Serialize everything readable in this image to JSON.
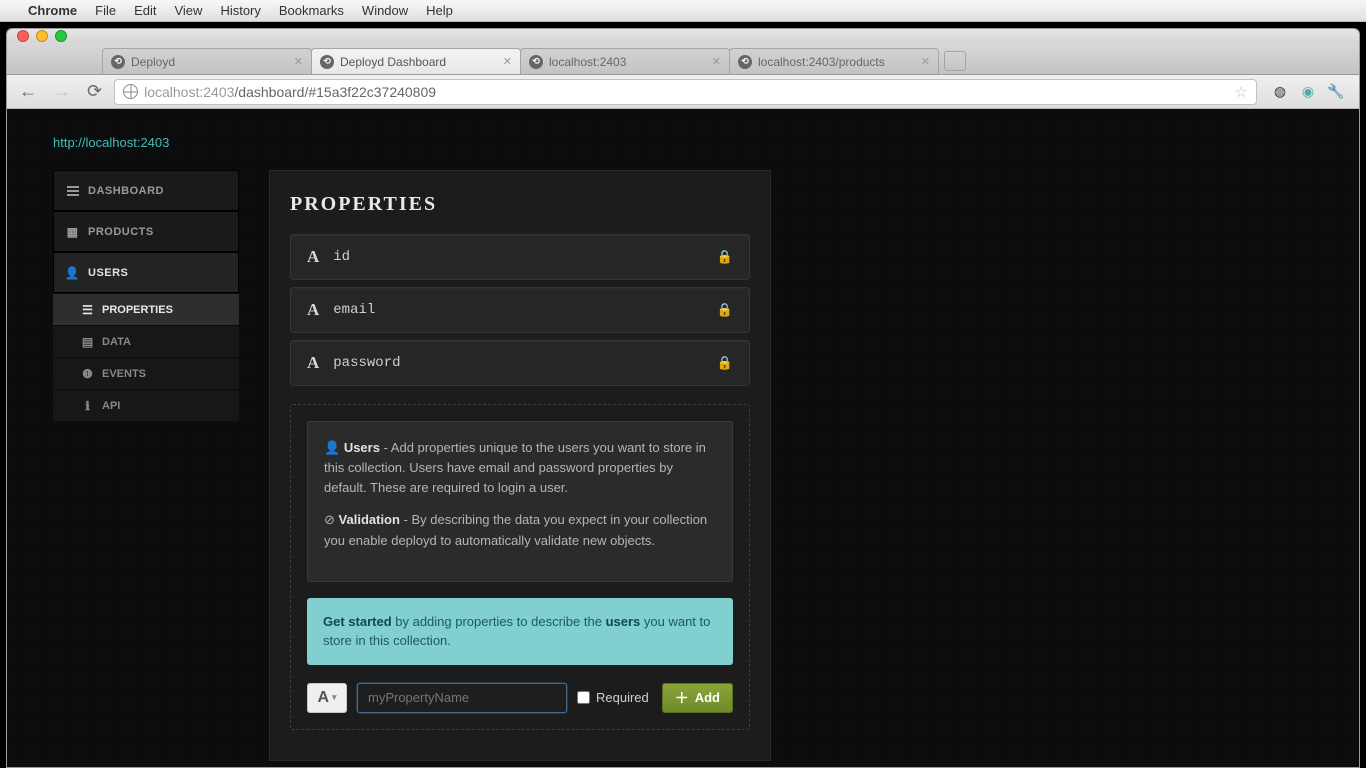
{
  "mac_menu": {
    "apple": "",
    "app": "Chrome",
    "items": [
      "File",
      "Edit",
      "View",
      "History",
      "Bookmarks",
      "Window",
      "Help"
    ]
  },
  "chrome": {
    "tabs": [
      {
        "title": "Deployd"
      },
      {
        "title": "Deployd Dashboard"
      },
      {
        "title": "localhost:2403"
      },
      {
        "title": "localhost:2403/products"
      }
    ],
    "url_host": "localhost",
    "url_port": ":2403",
    "url_path": "/dashboard/#15a3f22c37240809"
  },
  "brand_link": "http://localhost:2403",
  "sidebar": {
    "items": [
      {
        "label": "DASHBOARD",
        "icon": "list"
      },
      {
        "label": "PRODUCTS",
        "icon": "grid"
      },
      {
        "label": "USERS",
        "icon": "user",
        "active": true
      }
    ],
    "sub": [
      {
        "label": "PROPERTIES",
        "icon": "list",
        "active": true
      },
      {
        "label": "DATA",
        "icon": "table"
      },
      {
        "label": "EVENTS",
        "icon": "info"
      },
      {
        "label": "API",
        "icon": "info"
      }
    ]
  },
  "main": {
    "heading": "PROPERTIES",
    "properties": [
      {
        "type": "A",
        "name": "id",
        "locked": true
      },
      {
        "type": "A",
        "name": "email",
        "locked": true
      },
      {
        "type": "A",
        "name": "password",
        "locked": true
      }
    ],
    "help": {
      "users_title": "Users",
      "users_body": " - Add properties unique to the users you want to store in this collection. Users have email and password properties by default. These are required to login a user.",
      "validation_title": "Validation",
      "validation_body": " - By describing the data you expect in your collection you enable deployd to automatically validate new objects."
    },
    "tip": {
      "lead": "Get started",
      "mid": " by adding properties to describe the ",
      "strong": "users",
      "tail": " you want to store in this collection."
    },
    "add": {
      "type_glyph": "A",
      "placeholder": "myPropertyName",
      "required_label": "Required",
      "button_label": "Add"
    }
  }
}
